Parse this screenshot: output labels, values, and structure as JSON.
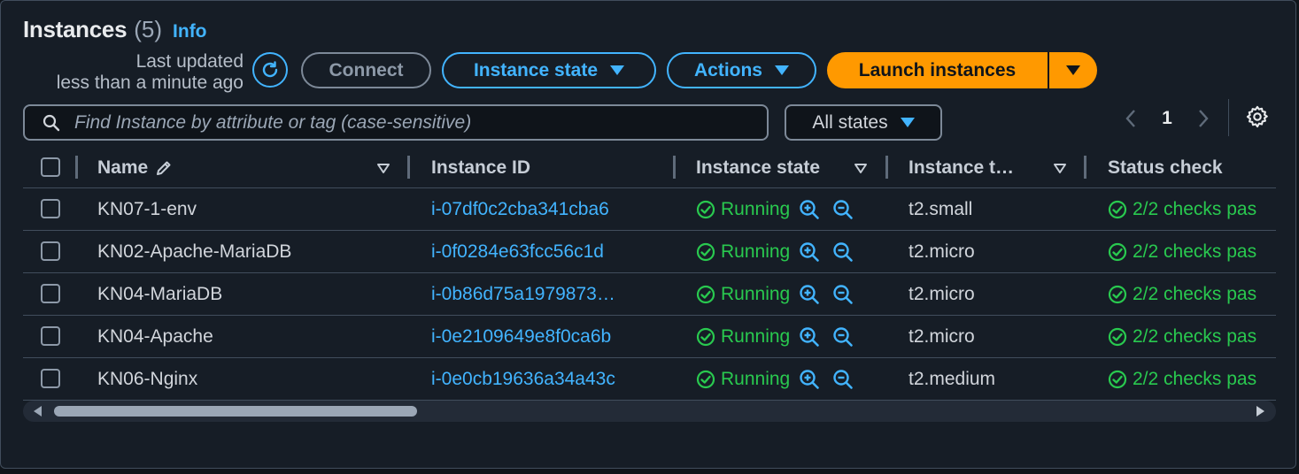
{
  "header": {
    "title": "Instances",
    "count": "(5)",
    "info_link": "Info",
    "last_updated_line1": "Last updated",
    "last_updated_line2": "less than a minute ago"
  },
  "toolbar": {
    "connect_label": "Connect",
    "instance_state_label": "Instance state",
    "actions_label": "Actions",
    "launch_label": "Launch instances"
  },
  "filter": {
    "search_placeholder": "Find Instance by attribute or tag (case-sensitive)",
    "states_label": "All states"
  },
  "pagination": {
    "current_page": "1",
    "prev_icon": "chevron-left-icon",
    "next_icon": "chevron-right-icon"
  },
  "table": {
    "columns": [
      "Name",
      "Instance ID",
      "Instance state",
      "Instance t…",
      "Status check"
    ],
    "rows": [
      {
        "name": "KN07-1-env",
        "instance_id": "i-07df0c2cba341cba6",
        "state": "Running",
        "type": "t2.small",
        "status": "2/2 checks pas"
      },
      {
        "name": "KN02-Apache-MariaDB",
        "instance_id": "i-0f0284e63fcc56c1d",
        "state": "Running",
        "type": "t2.micro",
        "status": "2/2 checks pas"
      },
      {
        "name": "KN04-MariaDB",
        "instance_id": "i-0b86d75a1979873…",
        "state": "Running",
        "type": "t2.micro",
        "status": "2/2 checks pas"
      },
      {
        "name": "KN04-Apache",
        "instance_id": "i-0e2109649e8f0ca6b",
        "state": "Running",
        "type": "t2.micro",
        "status": "2/2 checks pas"
      },
      {
        "name": "KN06-Nginx",
        "instance_id": "i-0e0cb19636a34a43c",
        "state": "Running",
        "type": "t2.medium",
        "status": "2/2 checks pas"
      }
    ]
  },
  "colors": {
    "accent": "#42b4ff",
    "primary_button": "#ff9900",
    "success": "#29c94f",
    "background": "#161d26"
  }
}
